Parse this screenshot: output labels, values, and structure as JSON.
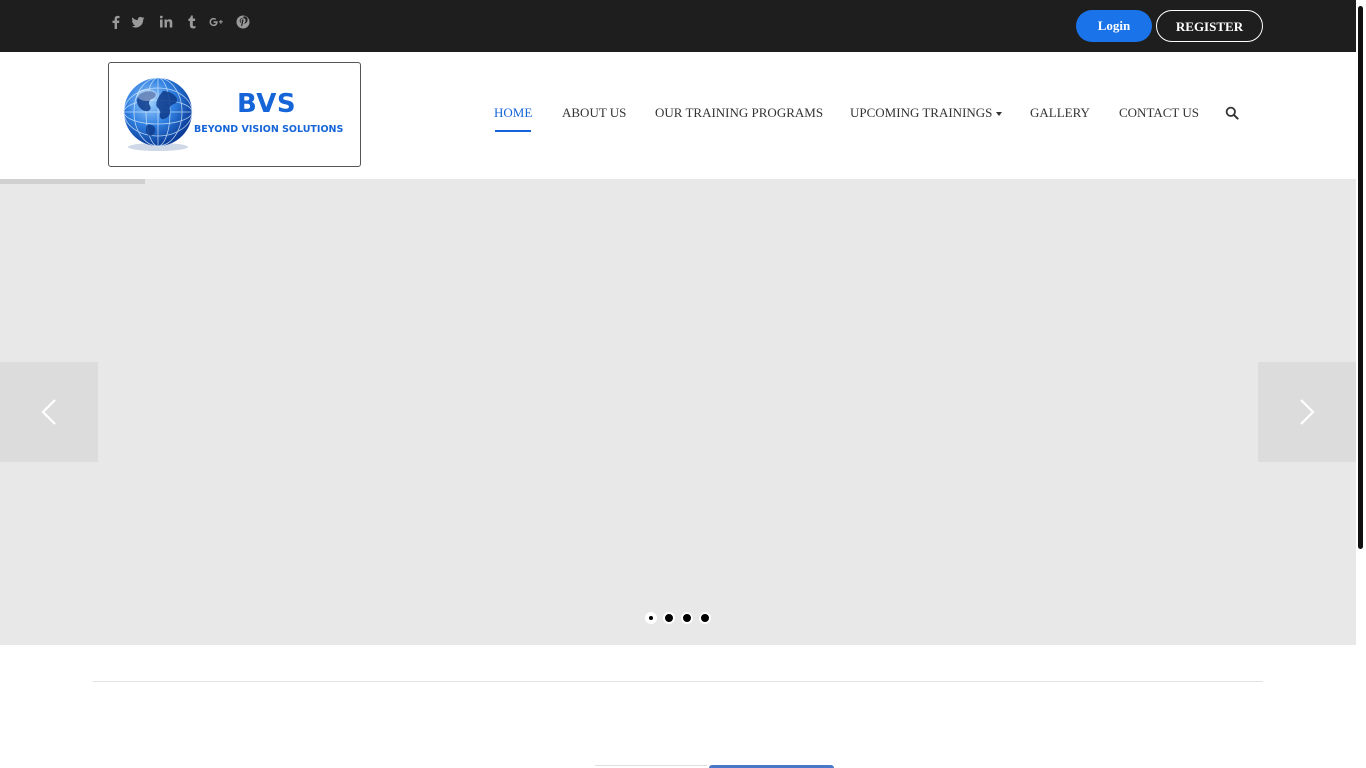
{
  "topbar": {
    "social_icons": [
      "facebook-icon",
      "twitter-icon",
      "linkedin-icon",
      "tumblr-icon",
      "google-plus-icon",
      "pinterest-icon"
    ],
    "login_label": "Login",
    "register_label": "REGISTER"
  },
  "logo": {
    "title": "BVS",
    "subtitle": "BEYOND VISION SOLUTIONS"
  },
  "nav": {
    "items": [
      {
        "label": "HOME",
        "active": true
      },
      {
        "label": "ABOUT US",
        "active": false
      },
      {
        "label": "OUR TRAINING PROGRAMS",
        "active": false
      },
      {
        "label": "UPCOMING TRAININGS",
        "active": false,
        "dropdown": true
      },
      {
        "label": "GALLERY",
        "active": false
      },
      {
        "label": "CONTACT US",
        "active": false
      }
    ]
  },
  "slider": {
    "slide_count": 4,
    "active_slide": 1,
    "progress": 0.107
  },
  "colors": {
    "topbar_bg": "#1e1e1e",
    "accent": "#1a73e8",
    "slider_bg": "#e8e8e8"
  }
}
